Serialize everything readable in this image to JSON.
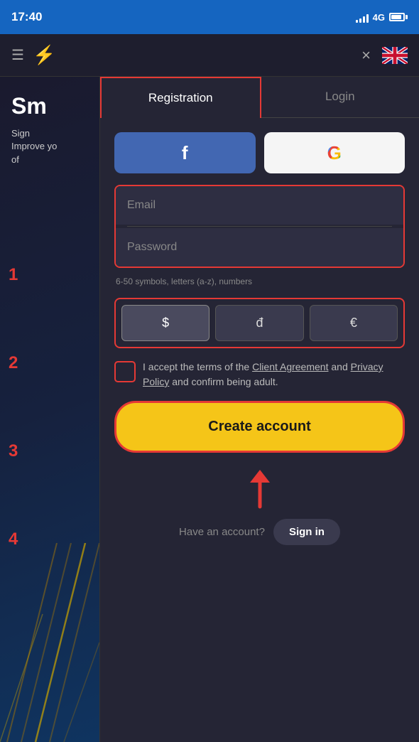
{
  "statusBar": {
    "time": "17:40",
    "signal": "4G"
  },
  "header": {
    "logo": "⚡",
    "close": "×"
  },
  "tabs": {
    "registration": "Registration",
    "login": "Login"
  },
  "social": {
    "facebook_label": "f",
    "google_label": "G"
  },
  "form": {
    "email_placeholder": "Email",
    "password_placeholder": "Password",
    "hint": "6-50 symbols, letters (a-z), numbers"
  },
  "currency": {
    "options": [
      "$",
      "đ",
      "€"
    ],
    "active_index": 0
  },
  "terms": {
    "text_before": "I accept the terms of the ",
    "client_agreement": "Client Agreement",
    "text_middle": " and ",
    "privacy_policy": "Privacy Policy",
    "text_after": " and confirm being adult."
  },
  "createBtn": "Create account",
  "bottom": {
    "have_account": "Have an account?",
    "sign_in": "Sign in"
  },
  "steps": {
    "labels": [
      "1",
      "2",
      "3",
      "4"
    ]
  },
  "bgPanel": {
    "title": "Sm",
    "subtitle_line1": "Sign",
    "subtitle_line2": "Improve yo",
    "subtitle_line3": "of"
  }
}
